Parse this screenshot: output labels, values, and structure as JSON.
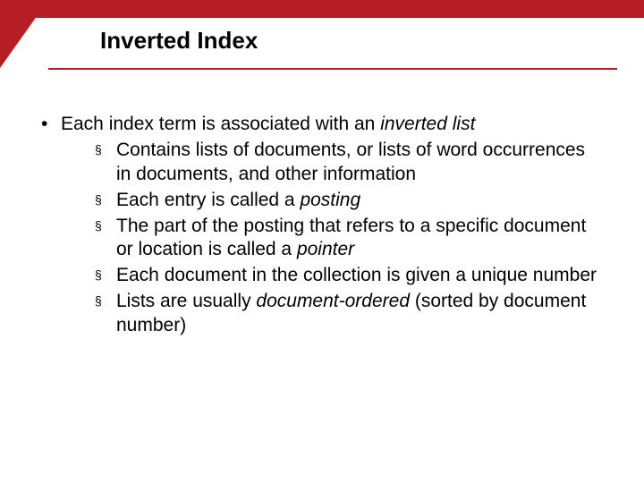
{
  "colors": {
    "accent": "#b41e24"
  },
  "title": "Inverted Index",
  "main": {
    "text_pre": "Each index term is associated with an ",
    "italic": "inverted list",
    "sub": [
      {
        "text": "Contains lists of documents, or lists of word occurrences in documents, and other information"
      },
      {
        "pre": "Each entry is called a ",
        "italic": "posting"
      },
      {
        "pre": "The part of the posting that refers to a specific document or location is called a ",
        "italic": "pointer"
      },
      {
        "text": "Each document in the collection is given a unique number"
      },
      {
        "pre": "Lists are usually ",
        "italic": "document-ordered",
        "post": " (sorted by document number)"
      }
    ]
  }
}
